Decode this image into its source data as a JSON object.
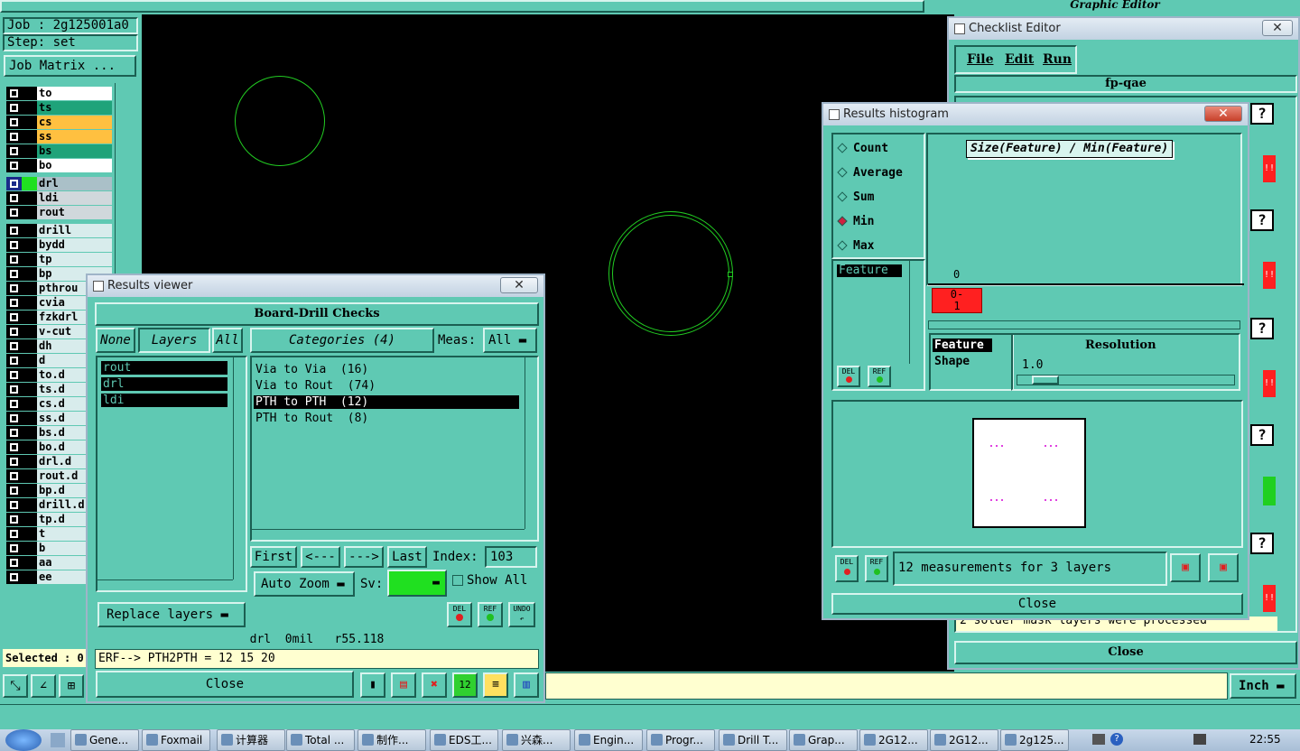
{
  "graphic_editor": {
    "title": "Graphic Editor",
    "job_label": "Job : 2g125001a0",
    "step_label": "Step: set",
    "job_matrix_button": "Job Matrix ...",
    "selected_label": "Selected : 0",
    "units_button": "Inch"
  },
  "layers": [
    {
      "name": "to",
      "color": "#ffffff"
    },
    {
      "name": "ts",
      "color": "#1fa37a"
    },
    {
      "name": "cs",
      "color": "#ffc040"
    },
    {
      "name": "ss",
      "color": "#ffc040"
    },
    {
      "name": "bs",
      "color": "#1fa37a"
    },
    {
      "name": "bo",
      "color": "#ffffff"
    },
    {
      "name": "drl",
      "color": "#aac0c8",
      "active": true
    },
    {
      "name": "ldi",
      "color": "#d0d8dc"
    },
    {
      "name": "rout",
      "color": "#d0d8dc"
    },
    {
      "name": "drill",
      "color": "#d8ecec"
    },
    {
      "name": "bydd",
      "color": "#d8ecec"
    },
    {
      "name": "tp",
      "color": "#d8ecec"
    },
    {
      "name": "bp",
      "color": "#d8ecec"
    },
    {
      "name": "pthrou",
      "color": "#d8ecec"
    },
    {
      "name": "cvia",
      "color": "#d8ecec"
    },
    {
      "name": "fzkdrl",
      "color": "#d8ecec"
    },
    {
      "name": "v-cut",
      "color": "#d8ecec"
    },
    {
      "name": "dh",
      "color": "#d8ecec"
    },
    {
      "name": "d",
      "color": "#d8ecec"
    },
    {
      "name": "to.d",
      "color": "#d8ecec"
    },
    {
      "name": "ts.d",
      "color": "#d8ecec"
    },
    {
      "name": "cs.d",
      "color": "#d8ecec"
    },
    {
      "name": "ss.d",
      "color": "#d8ecec"
    },
    {
      "name": "bs.d",
      "color": "#d8ecec"
    },
    {
      "name": "bo.d",
      "color": "#d8ecec"
    },
    {
      "name": "drl.d",
      "color": "#d8ecec"
    },
    {
      "name": "rout.d",
      "color": "#d8ecec"
    },
    {
      "name": "bp.d",
      "color": "#d8ecec"
    },
    {
      "name": "drill.d",
      "color": "#d8ecec"
    },
    {
      "name": "tp.d",
      "color": "#d8ecec"
    },
    {
      "name": "t",
      "color": "#d8ecec"
    },
    {
      "name": "b",
      "color": "#d8ecec"
    },
    {
      "name": "aa",
      "color": "#d8ecec"
    },
    {
      "name": "ee",
      "color": "#d8ecec"
    }
  ],
  "results_viewer": {
    "title": "Results viewer",
    "header": "Board-Drill Checks",
    "none_btn": "None",
    "layers_btn": "Layers",
    "all_btn": "All",
    "categories_btn": "Categories (4)",
    "meas_label": "Meas:",
    "meas_value": "All",
    "layer_items": [
      "rout",
      "drl",
      "ldi"
    ],
    "categories": [
      "Via to Via  (16)",
      "Via to Rout  (74)",
      "PTH to PTH  (12)",
      "PTH to Rout  (8)"
    ],
    "first_btn": "First",
    "prev_btn": "<---",
    "next_btn": "--->",
    "last_btn": "Last",
    "index_label": "Index:",
    "index_value": "103",
    "auto_zoom_btn": "Auto Zoom",
    "sv_label": "Sv:",
    "show_all_label": "Show All",
    "replace_layers_btn": "Replace layers",
    "del_btn": "DEL",
    "ref_btn": "REF",
    "undo_btn": "UNDO",
    "status_line": "drl  0mil   r55.118",
    "erf_line": "ERF--> PTH2PTH = 12 15 20",
    "close_btn": "Close"
  },
  "checklist_editor": {
    "title": "Checklist Editor",
    "menu": [
      "File",
      "Edit",
      "Run"
    ],
    "name": "fp-qae",
    "status_text": "2 solder mask layers were processed",
    "close_btn": "Close"
  },
  "results_histogram": {
    "title": "Results histogram",
    "options": [
      "Count",
      "Average",
      "Sum",
      "Min",
      "Max"
    ],
    "selected_option": "Min",
    "metric_title": "Size(Feature) / Min(Feature)",
    "axis_zero": "0",
    "bin_label": "0-\n1",
    "list_items": [
      "Feature"
    ],
    "feature_label": "Feature",
    "shape_label": "Shape",
    "resolution_label": "Resolution",
    "resolution_value": "1.0",
    "del_btn": "DEL",
    "ref_btn": "REF",
    "measurements_text": "12 measurements for 3 layers",
    "close_btn": "Close"
  },
  "taskbar": {
    "items": [
      "Gene...",
      "Foxmail",
      "计算器",
      "Total ...",
      "制作...",
      "EDS工...",
      "兴森...",
      "Engin...",
      "Progr...",
      "Drill T...",
      "Grap...",
      "2G12...",
      "2G12...",
      "2g125..."
    ],
    "clock": "22:55"
  },
  "colors": {
    "teal": "#5fc9b3",
    "canvas": "#000000",
    "feature": "#22cc22",
    "highlight_red": "#ff2020"
  }
}
